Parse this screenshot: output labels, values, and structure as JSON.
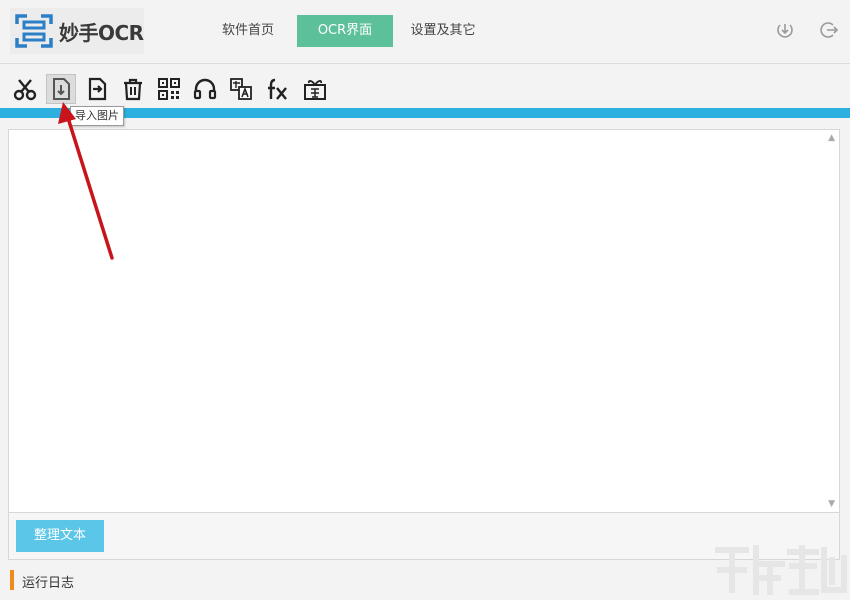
{
  "app": {
    "logo_text": "妙手OCR"
  },
  "nav": {
    "home": "软件首页",
    "ocr": "OCR界面",
    "settings": "设置及其它"
  },
  "toolbar": {
    "tools": [
      "scissors-icon",
      "import-image-icon",
      "export-file-icon",
      "trash-icon",
      "qr-code-icon",
      "headset-icon",
      "translate-icon",
      "formula-icon",
      "reward-gift-icon"
    ],
    "tooltip": "导入图片"
  },
  "main": {
    "arrange_button": "整理文本"
  },
  "log": {
    "label": "运行日志"
  },
  "colors": {
    "accent_green": "#5cc09a",
    "blue_bar": "#2db0e0",
    "button_blue": "#5bc6e8",
    "log_orange": "#f08a1c",
    "arrow_red": "#c8141a"
  }
}
